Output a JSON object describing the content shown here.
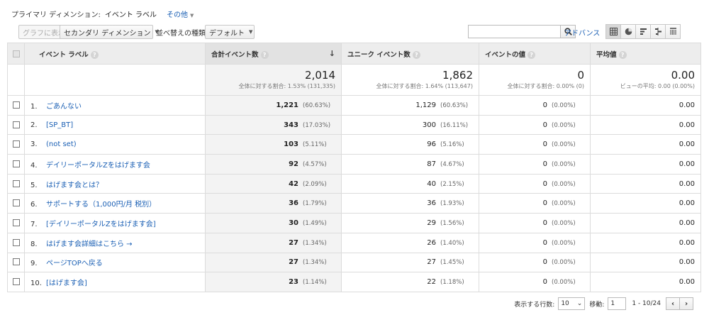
{
  "primary": {
    "label": "プライマリ ディメンション:",
    "value": "イベント ラベル",
    "other": "その他"
  },
  "toolbar": {
    "graph_button": "グラフに表示",
    "secondary_dimension": "セカンダリ ディメンション",
    "sort_label": "並べ替えの種類:",
    "sort_value": "デフォルト",
    "search_placeholder": "",
    "advanced": "アドバンス"
  },
  "table": {
    "headers": {
      "label": "イベント ラベル",
      "total_events": "合計イベント数",
      "unique_events": "ユニーク イベント数",
      "event_value": "イベントの値",
      "avg_value": "平均値"
    },
    "totals": {
      "total_events": "2,014",
      "total_events_sub": "全体に対する割合: 1.53% (131,335)",
      "unique_events": "1,862",
      "unique_events_sub": "全体に対する割合: 1.64% (113,647)",
      "event_value": "0",
      "event_value_sub": "全体に対する割合: 0.00% (0)",
      "avg_value": "0.00",
      "avg_value_sub": "ビューの平均: 0.00 (0.00%)"
    },
    "rows": [
      {
        "idx": "1.",
        "label": "ごあんない",
        "te": "1,221",
        "te_pct": "(60.63%)",
        "ue": "1,129",
        "ue_pct": "(60.63%)",
        "ev": "0",
        "ev_pct": "(0.00%)",
        "avg": "0.00"
      },
      {
        "idx": "2.",
        "label": "[SP_BT]",
        "te": "343",
        "te_pct": "(17.03%)",
        "ue": "300",
        "ue_pct": "(16.11%)",
        "ev": "0",
        "ev_pct": "(0.00%)",
        "avg": "0.00"
      },
      {
        "idx": "3.",
        "label": "(not set)",
        "te": "103",
        "te_pct": "(5.11%)",
        "ue": "96",
        "ue_pct": "(5.16%)",
        "ev": "0",
        "ev_pct": "(0.00%)",
        "avg": "0.00"
      },
      {
        "idx": "4.",
        "label": "デイリーポータルZをはげます会",
        "te": "92",
        "te_pct": "(4.57%)",
        "ue": "87",
        "ue_pct": "(4.67%)",
        "ev": "0",
        "ev_pct": "(0.00%)",
        "avg": "0.00"
      },
      {
        "idx": "5.",
        "label": "はげます会とは？",
        "te": "42",
        "te_pct": "(2.09%)",
        "ue": "40",
        "ue_pct": "(2.15%)",
        "ev": "0",
        "ev_pct": "(0.00%)",
        "avg": "0.00"
      },
      {
        "idx": "6.",
        "label": "サポートする（1,000円/月 税別）",
        "te": "36",
        "te_pct": "(1.79%)",
        "ue": "36",
        "ue_pct": "(1.93%)",
        "ev": "0",
        "ev_pct": "(0.00%)",
        "avg": "0.00"
      },
      {
        "idx": "7.",
        "label": "[デイリーポータルZをはげます会]",
        "te": "30",
        "te_pct": "(1.49%)",
        "ue": "29",
        "ue_pct": "(1.56%)",
        "ev": "0",
        "ev_pct": "(0.00%)",
        "avg": "0.00"
      },
      {
        "idx": "8.",
        "label": "はげます会詳細はこちら →",
        "te": "27",
        "te_pct": "(1.34%)",
        "ue": "26",
        "ue_pct": "(1.40%)",
        "ev": "0",
        "ev_pct": "(0.00%)",
        "avg": "0.00"
      },
      {
        "idx": "9.",
        "label": "ページTOPへ戻る",
        "te": "27",
        "te_pct": "(1.34%)",
        "ue": "27",
        "ue_pct": "(1.45%)",
        "ev": "0",
        "ev_pct": "(0.00%)",
        "avg": "0.00"
      },
      {
        "idx": "10.",
        "label": "[はげます会]",
        "te": "23",
        "te_pct": "(1.14%)",
        "ue": "22",
        "ue_pct": "(1.18%)",
        "ev": "0",
        "ev_pct": "(0.00%)",
        "avg": "0.00"
      }
    ]
  },
  "footer": {
    "rows_label": "表示する行数:",
    "rows_value": "10",
    "goto_label": "移動:",
    "goto_value": "1",
    "range": "1 - 10/24"
  },
  "colors": {
    "link": "#1a5fb4",
    "header_bg": "#ededed"
  }
}
